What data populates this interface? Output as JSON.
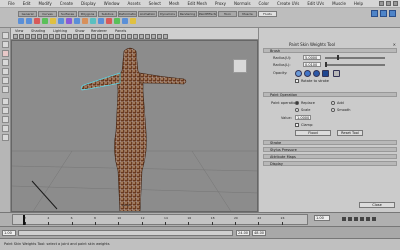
{
  "menubar": {
    "items": [
      "File",
      "Edit",
      "Modify",
      "Create",
      "Display",
      "Window",
      "Assets",
      "Select",
      "Mesh",
      "Edit Mesh",
      "Proxy",
      "Normals",
      "Color",
      "Create UVs",
      "Edit UVs",
      "Muscle",
      "Help"
    ]
  },
  "shelf": {
    "tabs": [
      "General",
      "Curves",
      "Surfaces",
      "Polygons",
      "Subdivs",
      "Deformation",
      "Animation",
      "Dynamics",
      "Rendering",
      "PaintEffects",
      "Toon",
      "Muscle",
      "Fluids"
    ],
    "icon_colors": [
      "#5a8fd8",
      "#5a8fd8",
      "#d85a5a",
      "#5ac05a",
      "#e0c040",
      "#5a8fd8",
      "#8a5ad8",
      "#5a8fd8",
      "#d8905a",
      "#5ac0c0",
      "#5a8fd8",
      "#d85a5a",
      "#5ac05a",
      "#5a8fd8",
      "#e0c040"
    ]
  },
  "viewport": {
    "menu": [
      "View",
      "Shading",
      "Lighting",
      "Show",
      "Renderer",
      "Panels"
    ],
    "caption": "persp",
    "mesh_color": "#6b3a1f",
    "wire_color": "#e8e8e8",
    "selected_color": "#5ed6e6",
    "grid_color": "#707070"
  },
  "panel": {
    "title": "Paint Skin Weights Tool",
    "reset_label": "Reset Tool",
    "sections": {
      "brush": "Brush",
      "paint_operation": "Paint Operation",
      "stroke": "Stroke",
      "stylus_pressure": "Stylus Pressure",
      "attribute_maps": "Attribute Maps",
      "display": "Display"
    },
    "radius_u_label": "Radius(U):",
    "radius_u_value": "5.0000",
    "radius_l_label": "Radius(L):",
    "radius_l_value": "0.0100",
    "opacity_label": "Opacity:",
    "accessory_label": "Rotate to stroke",
    "paint_op_label": "Paint operation:",
    "op_replace": "Replace",
    "op_add": "Add",
    "op_scale": "Scale",
    "op_smooth": "Smooth",
    "value_label": "Value:",
    "value_value": "1.0000",
    "clamp_label": "Clamp:",
    "flood_label": "Flood",
    "cancel_label": "Close"
  },
  "timeline": {
    "ticks": [
      "2",
      "4",
      "6",
      "8",
      "10",
      "12",
      "14",
      "16",
      "18",
      "20",
      "22",
      "24"
    ],
    "current_frame": "1.00",
    "start": "1.00",
    "end": "24.00",
    "end2": "48.00",
    "range_start": "1.00"
  },
  "cmdline": {
    "help": "Paint Skin Weights Tool: select a joint and paint skin weights"
  }
}
